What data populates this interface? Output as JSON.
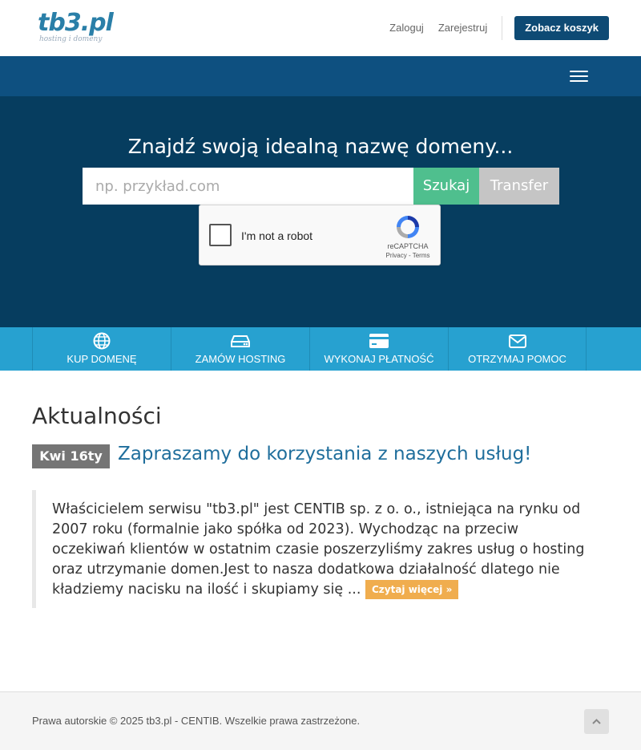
{
  "header": {
    "logo_text": "tb3.pl",
    "logo_tagline": "hosting i domeny",
    "login_label": "Zaloguj",
    "register_label": "Zarejestruj",
    "cart_label": "Zobacz koszyk",
    "brand_color": "#0e4a74"
  },
  "hero": {
    "title": "Znajdź swoją idealną nazwę domeny...",
    "search_placeholder": "np. przykład.com",
    "search_value": "",
    "search_button": "Szukaj",
    "transfer_button": "Transfer",
    "captcha_label": "I'm not a robot",
    "captcha_brand": "reCAPTCHA",
    "captcha_privacy": "Privacy",
    "captcha_terms": "Terms"
  },
  "actions": [
    {
      "label": "KUP DOMENĘ",
      "icon": "globe-icon"
    },
    {
      "label": "ZAMÓW HOSTING",
      "icon": "server-icon"
    },
    {
      "label": "WYKONAJ PŁATNOŚĆ",
      "icon": "credit-card-icon"
    },
    {
      "label": "OTRZYMAJ POMOC",
      "icon": "envelope-icon"
    }
  ],
  "news": {
    "heading": "Aktualności",
    "items": [
      {
        "date": "Kwi 16ty",
        "title": "Zapraszamy do korzystania z naszych usług!",
        "body": "Właścicielem serwisu \"tb3.pl\" jest CENTIB sp. z o. o., istniejąca na rynku od 2007 roku (formalnie jako spółka od 2023). Wychodząc na przeciw oczekiwań klientów w ostatnim czasie poszerzyliśmy zakres usług o hosting oraz utrzymanie domen.Jest to nasza dodatkowa działalność dlatego nie kładziemy nacisku na ilość i skupiamy się ...",
        "read_more": "Czytaj więcej »"
      }
    ]
  },
  "footer": {
    "copyright": "Prawa autorskie © 2025 tb3.pl - CENTIB. Wszelkie prawa zastrzeżone."
  }
}
